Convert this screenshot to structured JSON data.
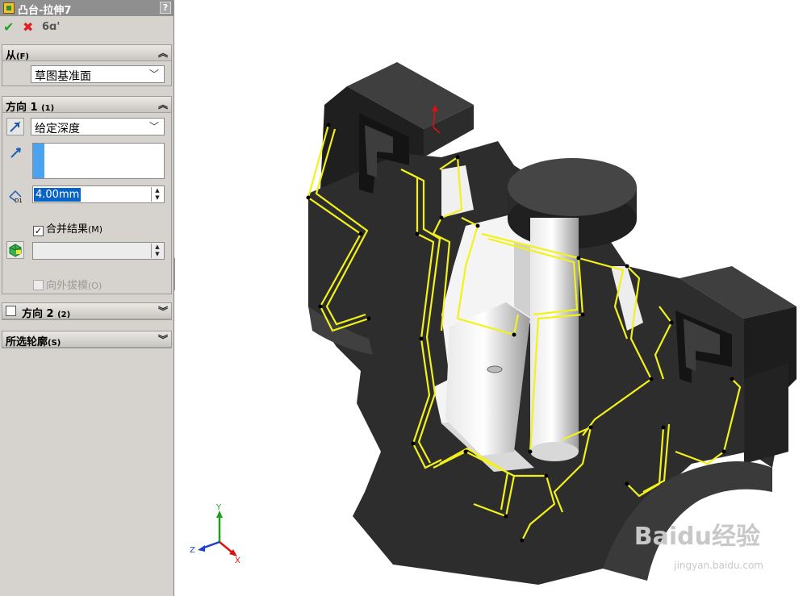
{
  "panel": {
    "title": "凸台-拉伸7",
    "help": "?",
    "actions": {
      "ok": "✔",
      "cancel": "✖",
      "preview": "6ɑ'"
    },
    "from": {
      "label": "从",
      "shortcut": "(F)",
      "value": "草图基准面"
    },
    "direction1": {
      "label": "方向 1",
      "shortcut": "(1)",
      "end_condition": "给定深度",
      "depth": "4.00mm",
      "merge_label": "合并结果",
      "merge_shortcut": "(M)",
      "merge_checked": true,
      "draft_label": "向外拔模",
      "draft_shortcut": "(O)"
    },
    "direction2": {
      "label": "方向 2",
      "shortcut": "(2)"
    },
    "contours": {
      "label": "所选轮廓",
      "shortcut": "(S)"
    }
  },
  "viewport": {
    "triad": {
      "x": "X",
      "y": "Y",
      "z": "Z"
    },
    "watermark": "Baidu经验",
    "watermark_url": "jingyan.baidu.com"
  },
  "colors": {
    "panel_bg": "#d6d3ce",
    "title_bg": "#8f8f8f",
    "model_dark": "#2f2f2f",
    "highlight": "#f2f21a"
  }
}
